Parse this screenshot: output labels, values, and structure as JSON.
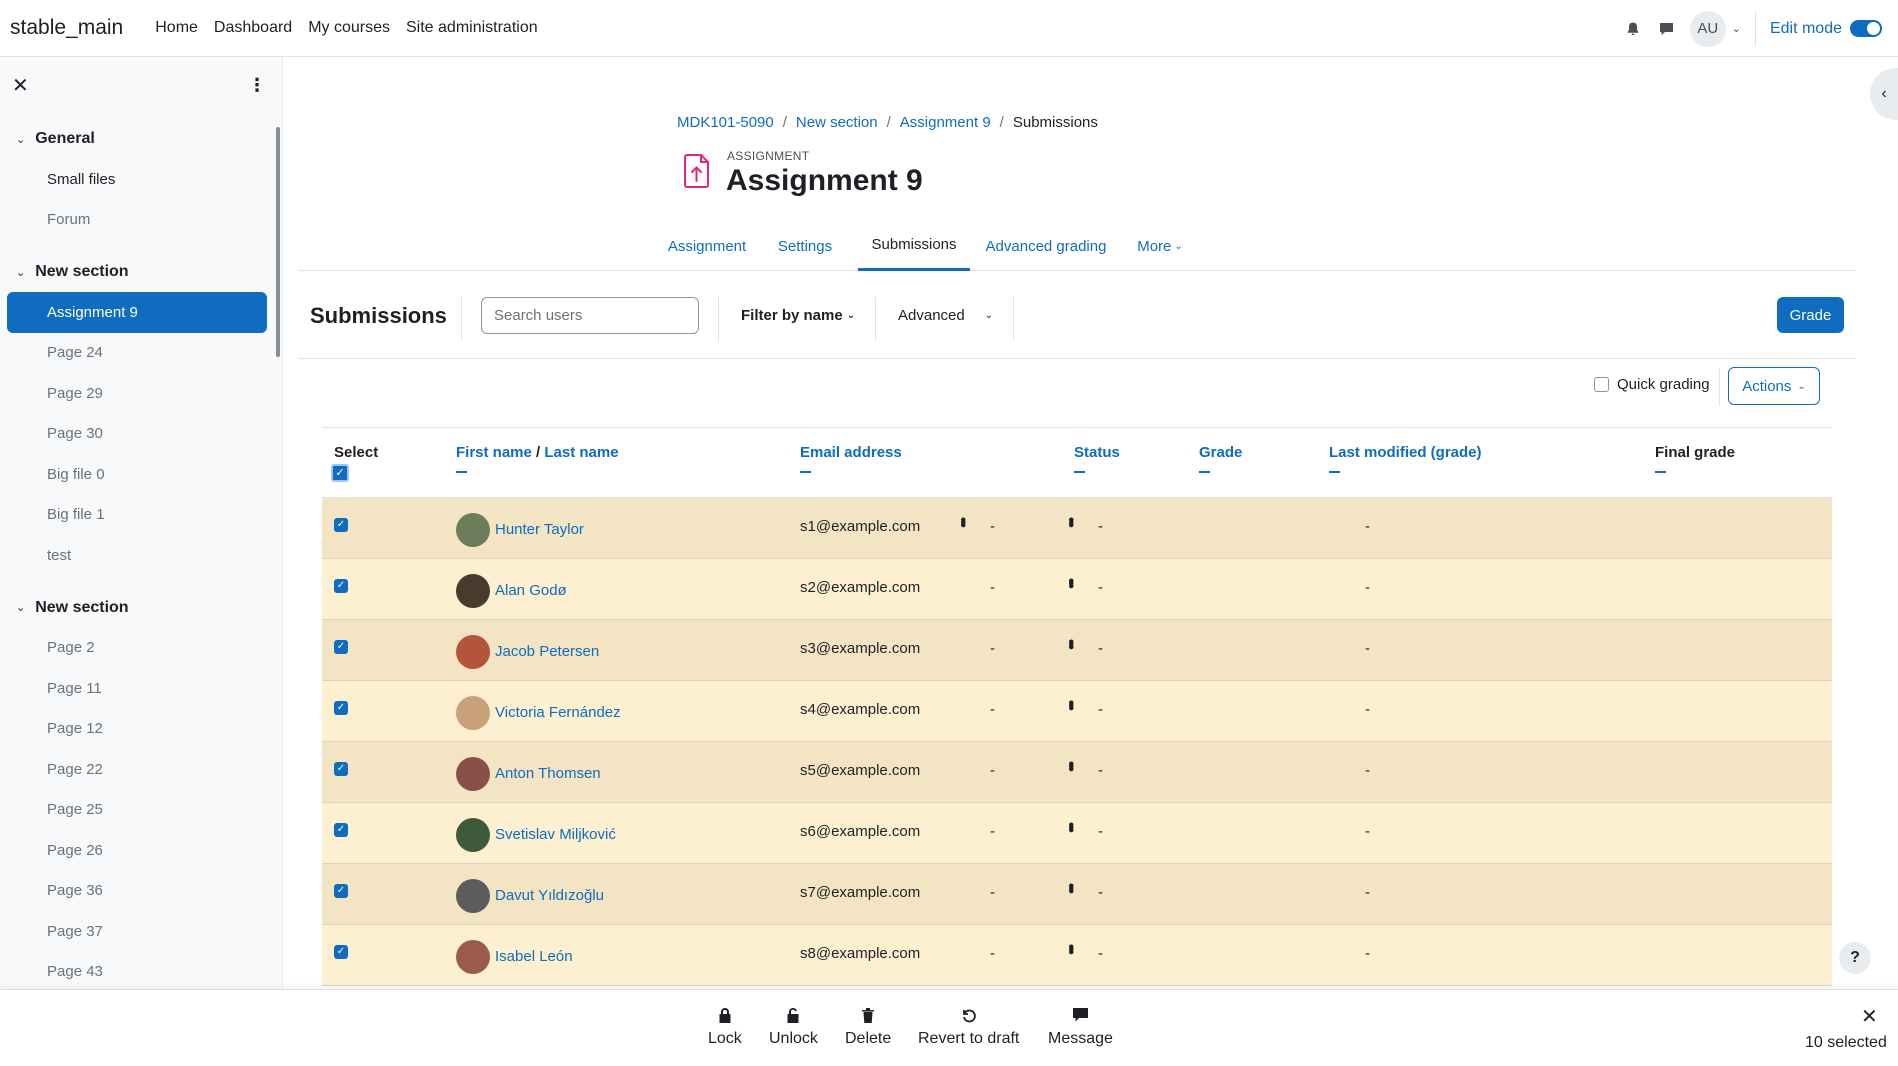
{
  "navbar": {
    "brand": "stable_main",
    "links": [
      "Home",
      "Dashboard",
      "My courses",
      "Site administration"
    ],
    "user_initials": "AU",
    "edit_mode_label": "Edit mode"
  },
  "drawer": {
    "sections": [
      {
        "title": "General",
        "items": [
          {
            "label": "Small files",
            "style": "normal"
          },
          {
            "label": "Forum",
            "style": "muted"
          }
        ]
      },
      {
        "title": "New section",
        "items": [
          {
            "label": "Assignment 9",
            "style": "active"
          },
          {
            "label": "Page 24",
            "style": "muted"
          },
          {
            "label": "Page 29",
            "style": "muted"
          },
          {
            "label": "Page 30",
            "style": "muted"
          },
          {
            "label": "Big file 0",
            "style": "muted"
          },
          {
            "label": "Big file 1",
            "style": "muted"
          },
          {
            "label": "test",
            "style": "muted"
          }
        ]
      },
      {
        "title": "New section",
        "items": [
          {
            "label": "Page 2",
            "style": "muted"
          },
          {
            "label": "Page 11",
            "style": "muted"
          },
          {
            "label": "Page 12",
            "style": "muted"
          },
          {
            "label": "Page 22",
            "style": "muted"
          },
          {
            "label": "Page 25",
            "style": "muted"
          },
          {
            "label": "Page 26",
            "style": "muted"
          },
          {
            "label": "Page 36",
            "style": "muted"
          },
          {
            "label": "Page 37",
            "style": "muted"
          },
          {
            "label": "Page 43",
            "style": "muted"
          }
        ]
      }
    ]
  },
  "breadcrumb": [
    "MDK101-5090",
    "New section",
    "Assignment 9",
    "Submissions"
  ],
  "header": {
    "activity_type": "ASSIGNMENT",
    "title": "Assignment 9"
  },
  "tabs": [
    "Assignment",
    "Settings",
    "Submissions",
    "Advanced grading",
    "More"
  ],
  "active_tab": "Submissions",
  "toolbar": {
    "heading": "Submissions",
    "search_placeholder": "Search users",
    "filter_label": "Filter by name",
    "advanced_label": "Advanced",
    "grade_label": "Grade",
    "quick_grading_label": "Quick grading",
    "actions_label": "Actions"
  },
  "table": {
    "columns": {
      "select": "Select",
      "first_name": "First name",
      "name_sep": "/",
      "last_name": "Last name",
      "email": "Email address",
      "status": "Status",
      "grade": "Grade",
      "last_modified": "Last modified (grade)",
      "final_grade": "Final grade"
    },
    "rows": [
      {
        "name": "Hunter Taylor",
        "email": "s1@example.com",
        "grade": "-",
        "last_modified": "-",
        "final_grade": "-",
        "status_menu": true,
        "avatar_color": "#6b7d5a"
      },
      {
        "name": "Alan Godø",
        "email": "s2@example.com",
        "grade": "-",
        "last_modified": "-",
        "final_grade": "-",
        "status_menu": false,
        "avatar_color": "#4a3a2e"
      },
      {
        "name": "Jacob Petersen",
        "email": "s3@example.com",
        "grade": "-",
        "last_modified": "-",
        "final_grade": "-",
        "status_menu": false,
        "avatar_color": "#b5533c"
      },
      {
        "name": "Victoria Fernández",
        "email": "s4@example.com",
        "grade": "-",
        "last_modified": "-",
        "final_grade": "-",
        "status_menu": false,
        "avatar_color": "#c9a27a"
      },
      {
        "name": "Anton Thomsen",
        "email": "s5@example.com",
        "grade": "-",
        "last_modified": "-",
        "final_grade": "-",
        "status_menu": false,
        "avatar_color": "#8a4f4a"
      },
      {
        "name": "Svetislav Miljković",
        "email": "s6@example.com",
        "grade": "-",
        "last_modified": "-",
        "final_grade": "-",
        "status_menu": false,
        "avatar_color": "#3f5a3a"
      },
      {
        "name": "Davut Yıldızoğlu",
        "email": "s7@example.com",
        "grade": "-",
        "last_modified": "-",
        "final_grade": "-",
        "status_menu": false,
        "avatar_color": "#5c5c5c"
      },
      {
        "name": "Isabel León",
        "email": "s8@example.com",
        "grade": "-",
        "last_modified": "-",
        "final_grade": "-",
        "status_menu": false,
        "avatar_color": "#9a5b4d"
      }
    ]
  },
  "bulk_actions": [
    "Lock",
    "Unlock",
    "Delete",
    "Revert to draft",
    "Message"
  ],
  "selected_count": "10 selected",
  "help_label": "?",
  "colors": {
    "accent": "#0f6cbf",
    "row_odd": "#f3e4c3",
    "row_even": "#fcf0d0",
    "activity_icon": "#e0267a"
  }
}
